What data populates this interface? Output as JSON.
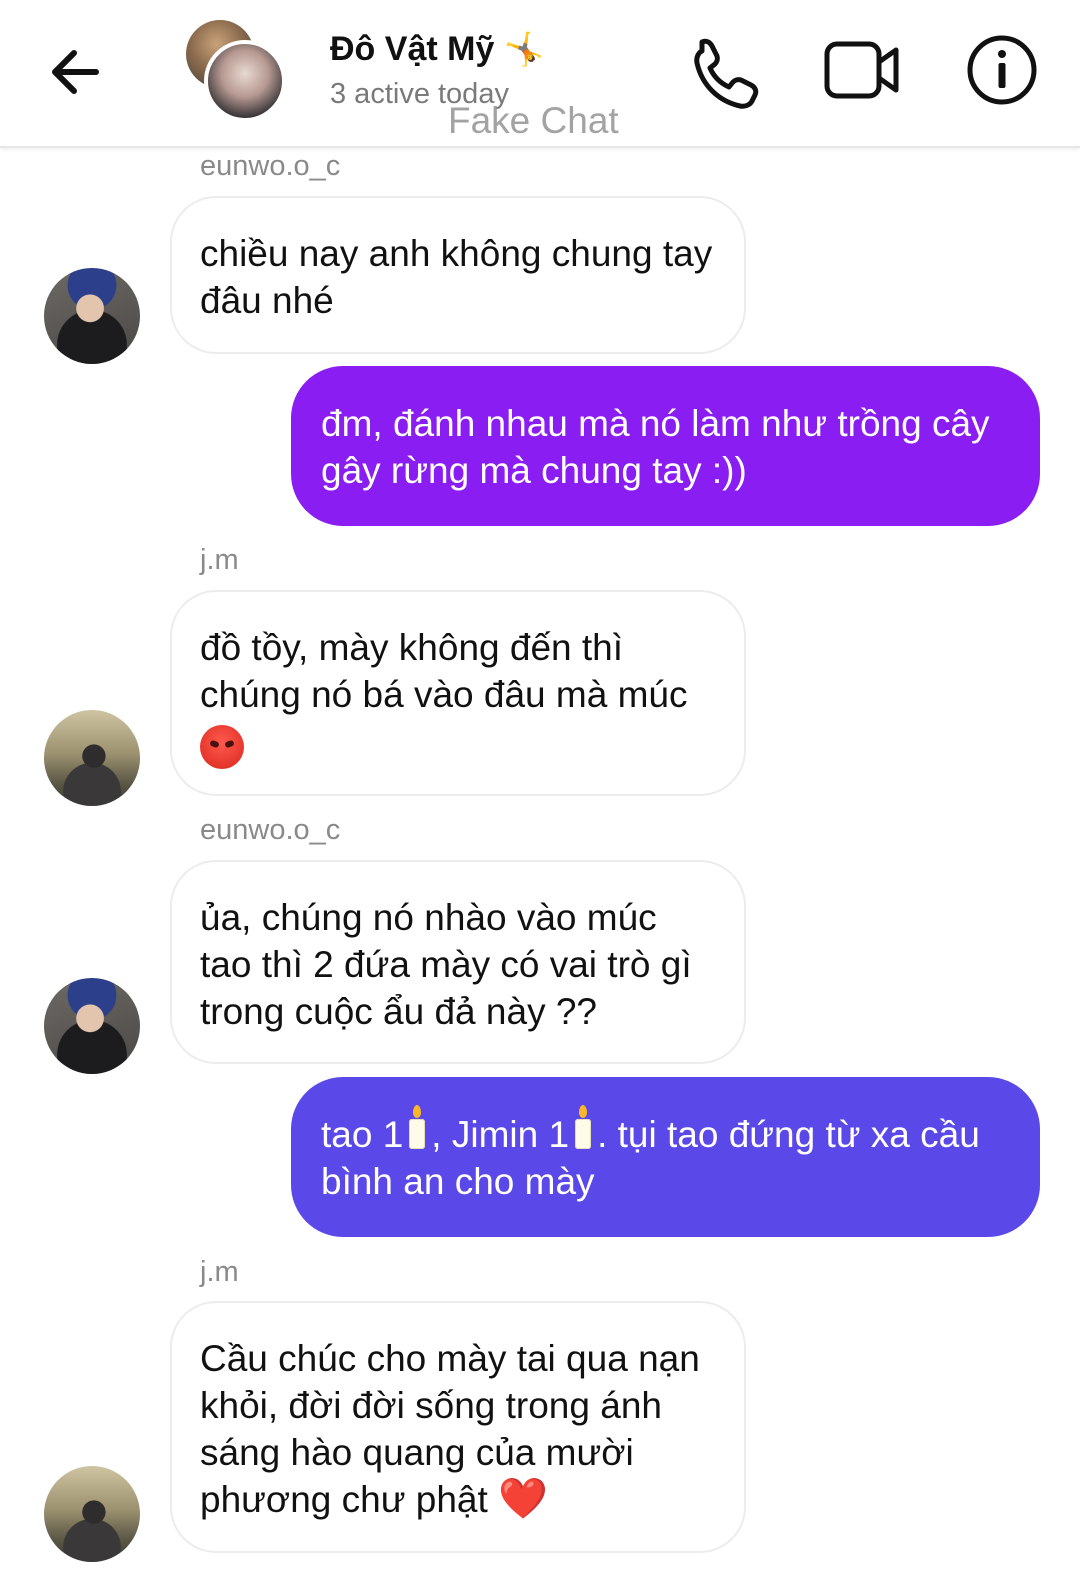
{
  "header": {
    "back_icon": "arrow-left-icon",
    "title": "Đô Vật Mỹ",
    "title_emoji": "🤸",
    "status": "3 active today",
    "watermark": "Fake Chat",
    "icons": [
      "phone-icon",
      "video-camera-icon",
      "info-icon"
    ]
  },
  "messages": [
    {
      "sender": "eunwo.o_c",
      "text": "chiều nay anh không chung tay đâu nhé",
      "direction": "incoming"
    },
    {
      "text": "đm, đánh nhau mà nó làm như trồng cây gây rừng mà chung tay :))",
      "direction": "outgoing",
      "color": "#8a1df2"
    },
    {
      "sender": "j.m",
      "line1": "đồ tồy, mày không đến thì chúng nó bá vào đâu mà múc",
      "emoji": "angry-face",
      "direction": "incoming"
    },
    {
      "sender": "eunwo.o_c",
      "text": "ủa, chúng nó nhào vào múc tao thì 2 đứa mày có vai trò gì trong cuộc ẩu đả này ??",
      "direction": "incoming"
    },
    {
      "part1": "tao 1",
      "part2": ", Jimin 1",
      "part3": ". tụi tao đứng từ xa cầu bình an cho mày",
      "emoji": "candle",
      "direction": "outgoing",
      "color": "#5a49e8"
    },
    {
      "sender": "j.m",
      "text": "Cầu chúc cho mày tai qua nạn khỏi, đời đời sống trong ánh sáng hào quang của mười phương chư phật",
      "emoji": "❤️",
      "direction": "incoming"
    }
  ]
}
